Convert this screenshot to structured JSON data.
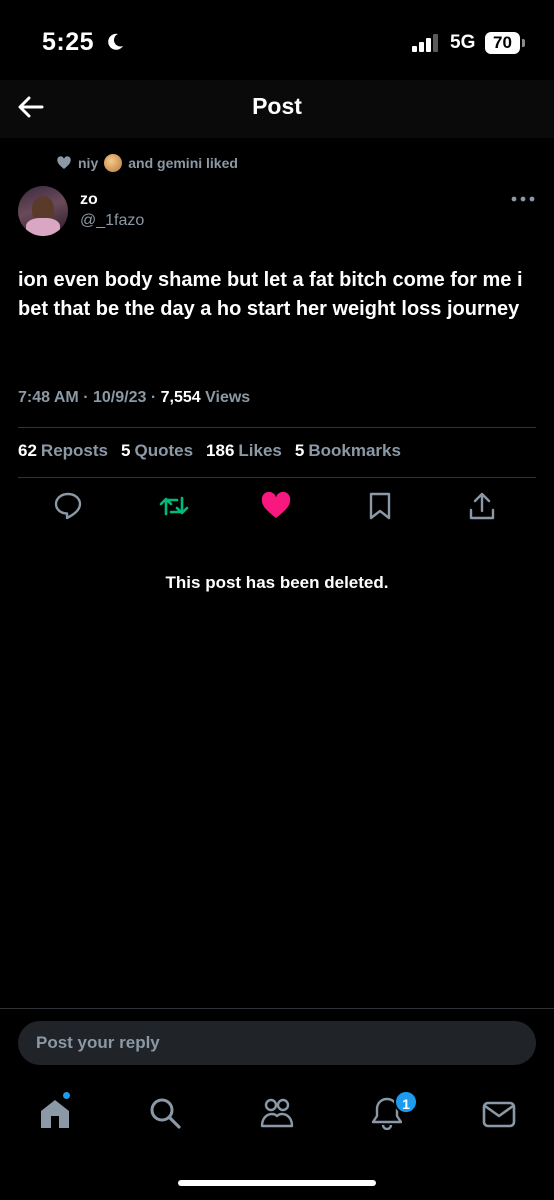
{
  "status_bar": {
    "time": "5:25",
    "network": "5G",
    "battery": "70"
  },
  "header": {
    "title": "Post"
  },
  "liked_by": {
    "user1": "niy",
    "text": "and gemini liked"
  },
  "author": {
    "name": "zo",
    "handle": "@_1fazo"
  },
  "tweet": {
    "text": "ion even body shame but let a fat bitch come for me i bet that be the day a ho start her weight loss journey",
    "time": "7:48 AM",
    "date": "10/9/23",
    "views_count": "7,554",
    "views_label": "Views"
  },
  "stats": {
    "reposts": {
      "count": "62",
      "label": "Reposts"
    },
    "quotes": {
      "count": "5",
      "label": "Quotes"
    },
    "likes": {
      "count": "186",
      "label": "Likes"
    },
    "bookmarks": {
      "count": "5",
      "label": "Bookmarks"
    }
  },
  "deleted_notice": "This post has been deleted.",
  "reply": {
    "placeholder": "Post your reply"
  },
  "nav": {
    "notifications_badge": "1"
  },
  "colors": {
    "background": "#000000",
    "repost_green": "#00ba7c",
    "like_pink": "#f91880",
    "accent_blue": "#1d9bf0",
    "muted": "#8b98a5"
  }
}
